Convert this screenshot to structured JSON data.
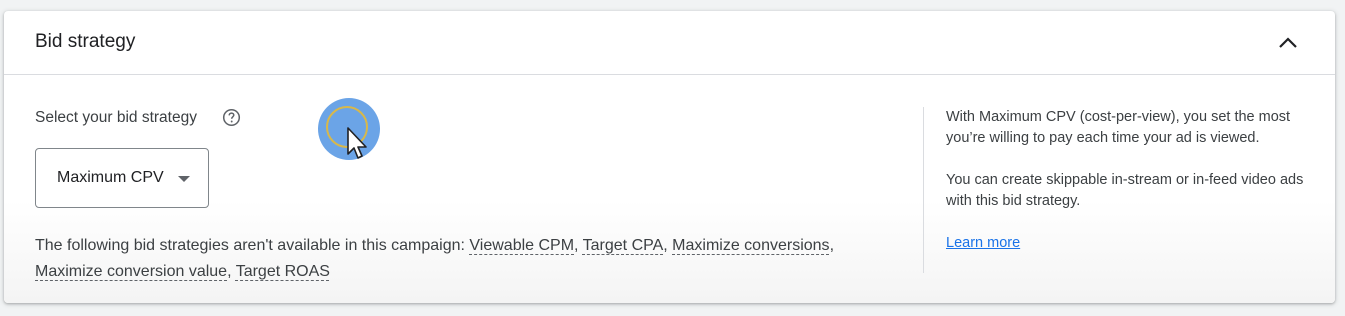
{
  "card": {
    "title": "Bid strategy",
    "collapse_icon": "chevron-up-icon"
  },
  "bid": {
    "select_label": "Select your bid strategy",
    "help_icon": "help-circle-icon",
    "dropdown_value": "Maximum CPV",
    "dropdown_icon": "caret-down-icon",
    "notice_text": "The following bid strategies aren't available in this campaign: ",
    "unavailable": [
      "Viewable CPM",
      "Target CPA",
      "Maximize conversions",
      "Maximize conversion value",
      "Target ROAS"
    ],
    "separator": ", "
  },
  "info": {
    "paragraph1": "With Maximum CPV (cost-per-view), you set the most you’re willing to pay each time your ad is viewed.",
    "paragraph2": "You can create skippable in-stream or in-feed video ads with this bid strategy.",
    "learn_more": "Learn more"
  },
  "colors": {
    "link": "#1a73e8",
    "cursor_highlight": "#4a90e2",
    "ring": "#d8b84a"
  }
}
